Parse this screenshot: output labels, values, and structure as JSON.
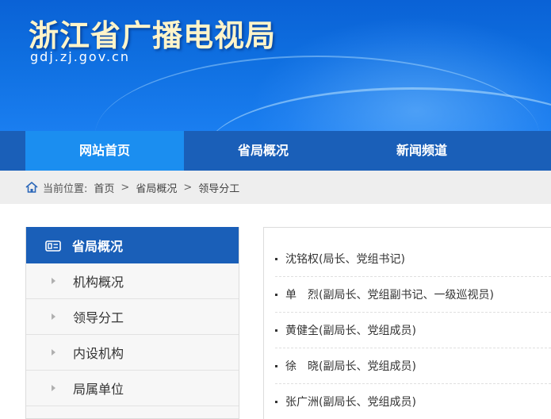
{
  "header": {
    "title": "浙江省广播电视局",
    "domain": "gdj.zj.gov.cn"
  },
  "nav": {
    "items": [
      {
        "label": "网站首页",
        "active": true
      },
      {
        "label": "省局概况",
        "active": false
      },
      {
        "label": "新闻频道",
        "active": false
      }
    ]
  },
  "breadcrumb": {
    "icon": "home-icon",
    "prefix": "当前位置:",
    "items": [
      "首页",
      "省局概况",
      "领导分工"
    ],
    "separator": ">"
  },
  "sidebar": {
    "heading": "省局概况",
    "heading_icon": "id-card-icon",
    "items": [
      {
        "label": "机构概况"
      },
      {
        "label": "领导分工"
      },
      {
        "label": "内设机构"
      },
      {
        "label": "局属单位"
      }
    ]
  },
  "leaders": {
    "items": [
      {
        "name": "沈铭权",
        "role": "(局长、党组书记)"
      },
      {
        "name": "单　烈",
        "role": "(副局长、党组副书记、一级巡视员)"
      },
      {
        "name": "黄健全",
        "role": "(副局长、党组成员)"
      },
      {
        "name": "徐　晓",
        "role": "(副局长、党组成员)"
      },
      {
        "name": "张广洲",
        "role": "(副局长、党组成员)"
      }
    ]
  },
  "colors": {
    "brand_blue": "#1a5fb8",
    "nav_active": "#1b8ef0",
    "title_gold": "#fff4c9"
  }
}
